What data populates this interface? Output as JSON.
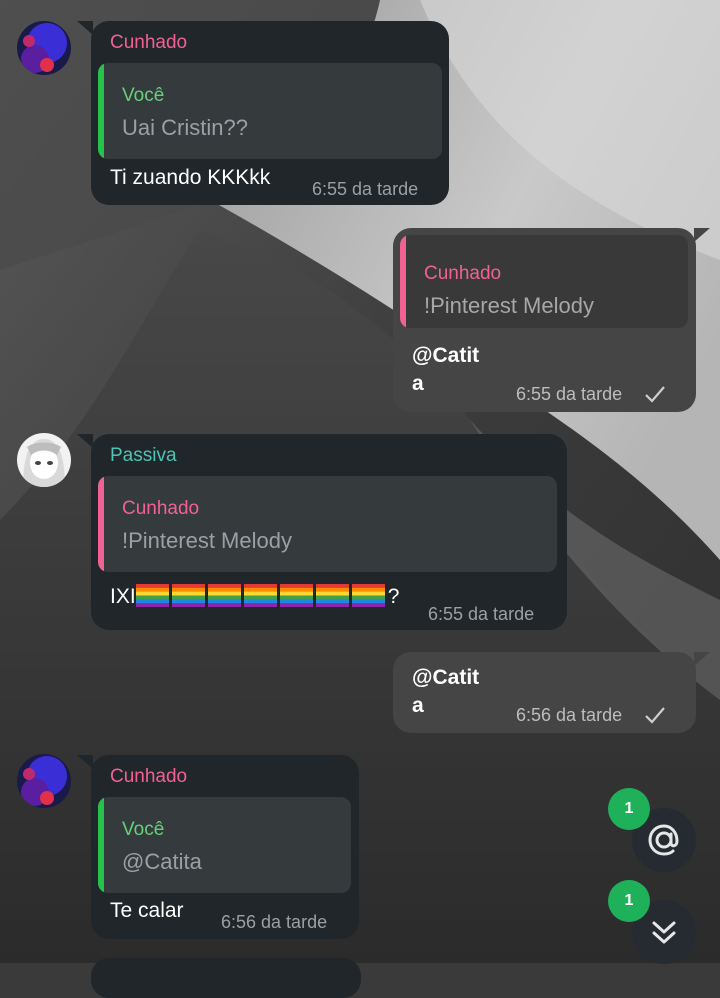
{
  "colors": {
    "incoming_bubble": "#20262a",
    "outgoing_bubble": "#454545",
    "name_pink": "#f06292",
    "name_teal": "#4fc3b4",
    "name_green": "#66d07a",
    "reply_bar_green": "#27c24a",
    "reply_bar_pink": "#f06292",
    "badge_green": "#1fb15a"
  },
  "messages": [
    {
      "direction": "incoming",
      "sender": "Cunhado",
      "avatar": "purple-blue-avatar",
      "reply_to": {
        "name": "Você",
        "text": "Uai Cristin??"
      },
      "text": "Ti zuando KKKkk",
      "time": "6:55 da tarde"
    },
    {
      "direction": "outgoing",
      "reply_to": {
        "name": "Cunhado",
        "text": "!Pinterest Melody"
      },
      "text_line1": "@Catit",
      "text_line2": "a",
      "time": "6:55 da tarde",
      "status": "sent-check"
    },
    {
      "direction": "incoming",
      "sender": "Passiva",
      "avatar": "anime-girl-avatar",
      "reply_to": {
        "name": "Cunhado",
        "text": "!Pinterest Melody"
      },
      "text_prefix": "IXI",
      "text_emoji": "rainbow-flag",
      "emoji_count": 7,
      "text_suffix": "?",
      "time": "6:55 da tarde"
    },
    {
      "direction": "outgoing",
      "text_line1": "@Catit",
      "text_line2": "a",
      "time": "6:56 da tarde",
      "status": "sent-check"
    },
    {
      "direction": "incoming",
      "sender": "Cunhado",
      "avatar": "purple-blue-avatar",
      "reply_to": {
        "name": "Você",
        "text": "@Catita"
      },
      "text": "Te calar",
      "time": "6:56 da tarde"
    }
  ],
  "floating_buttons": {
    "mentions": {
      "icon": "at-sign-icon",
      "badge": "1"
    },
    "scroll_down": {
      "icon": "double-chevron-down-icon",
      "badge": "1"
    }
  }
}
